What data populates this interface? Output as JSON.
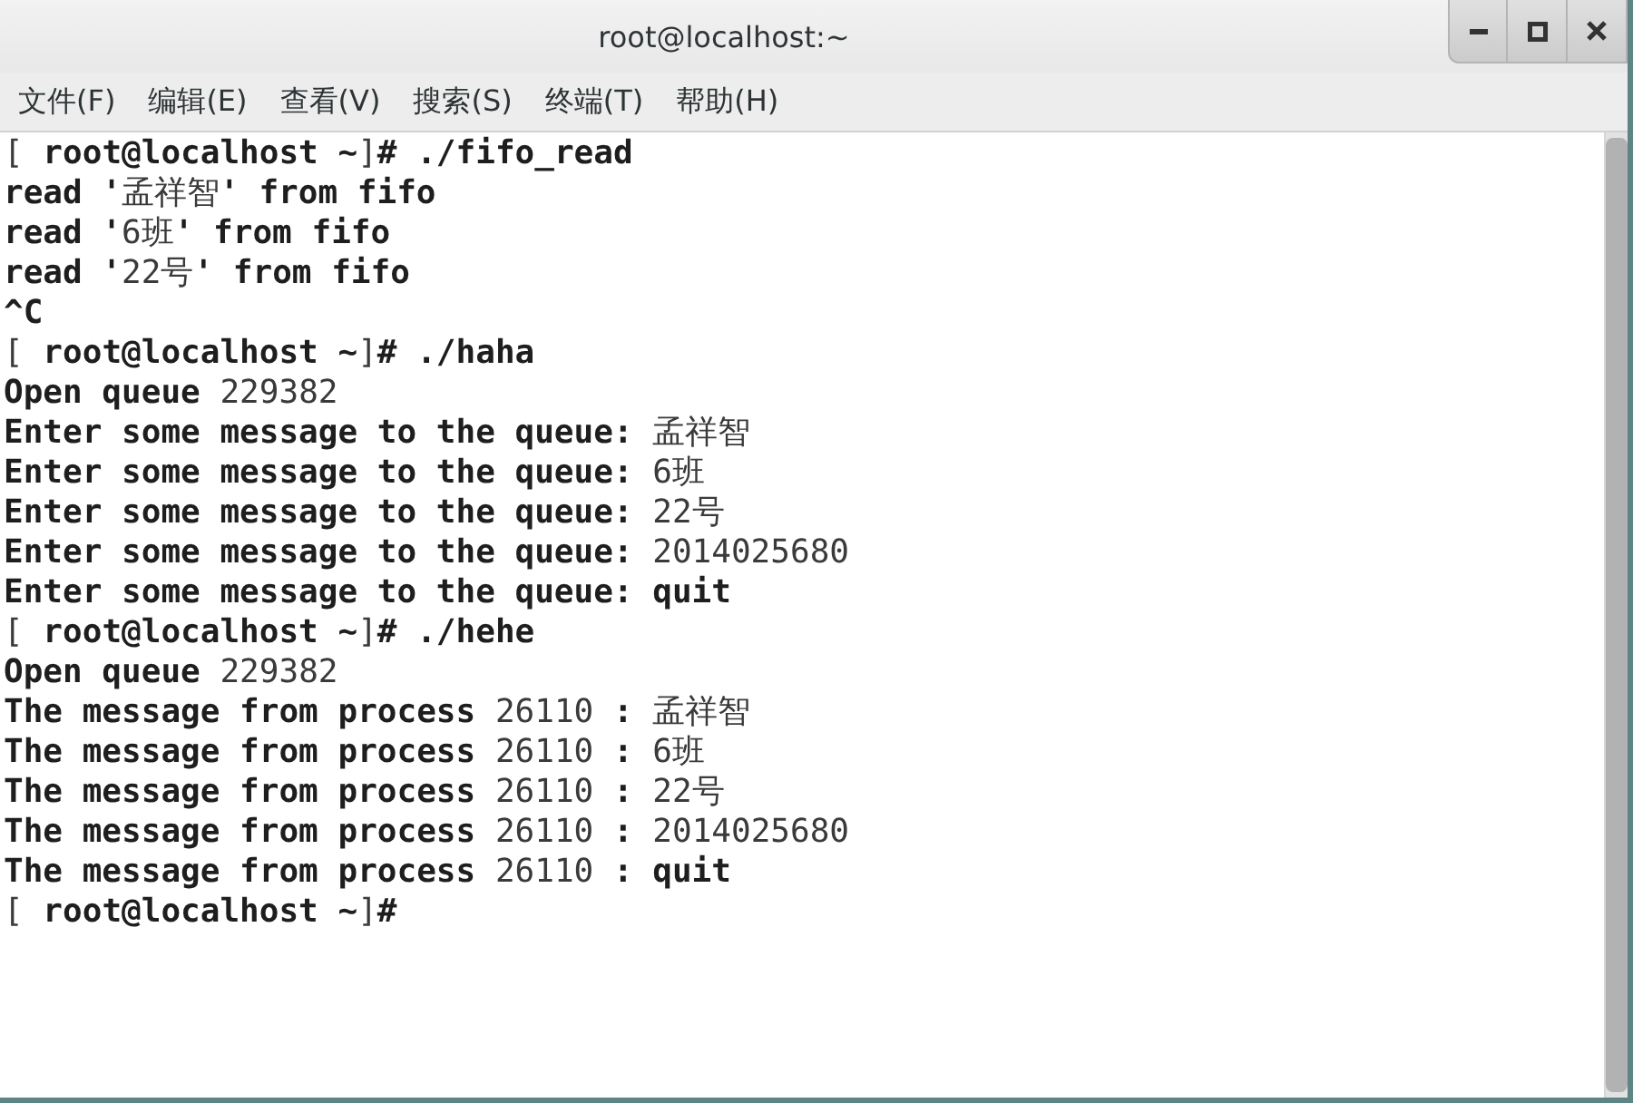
{
  "window": {
    "title": "root@localhost:~"
  },
  "menu_bar": {
    "items": [
      "文件(F)",
      "编辑(E)",
      "查看(V)",
      "搜索(S)",
      "终端(T)",
      "帮助(H)"
    ]
  },
  "terminal": {
    "lines": [
      "[ root@localhost ~]# ./fifo_read",
      "read '孟祥智' from fifo",
      "read '6班' from fifo",
      "read '22号' from fifo",
      "^C",
      "[ root@localhost ~]# ./haha",
      "Open queue 229382",
      "Enter some message to the queue: 孟祥智",
      "Enter some message to the queue: 6班",
      "Enter some message to the queue: 22号",
      "Enter some message to the queue: 2014025680",
      "Enter some message to the queue: quit",
      "[ root@localhost ~]# ./hehe",
      "Open queue 229382",
      "The message from process 26110 : 孟祥智",
      "The message from process 26110 : 6班",
      "The message from process 26110 : 22号",
      "The message from process 26110 : 2014025680",
      "The message from process 26110 : quit",
      "[ root@localhost ~]#"
    ]
  }
}
